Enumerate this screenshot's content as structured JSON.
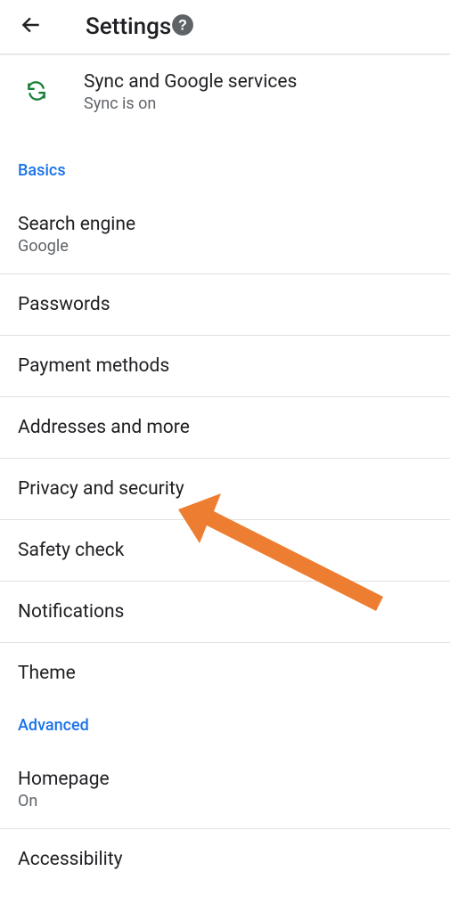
{
  "header": {
    "title": "Settings"
  },
  "sync": {
    "title": "Sync and Google services",
    "subtitle": "Sync is on"
  },
  "sections": {
    "basics": {
      "label": "Basics",
      "items": [
        {
          "title": "Search engine",
          "subtitle": "Google"
        },
        {
          "title": "Passwords"
        },
        {
          "title": "Payment methods"
        },
        {
          "title": "Addresses and more"
        },
        {
          "title": "Privacy and security"
        },
        {
          "title": "Safety check"
        },
        {
          "title": "Notifications"
        },
        {
          "title": "Theme"
        }
      ]
    },
    "advanced": {
      "label": "Advanced",
      "items": [
        {
          "title": "Homepage",
          "subtitle": "On"
        },
        {
          "title": "Accessibility"
        }
      ]
    }
  }
}
